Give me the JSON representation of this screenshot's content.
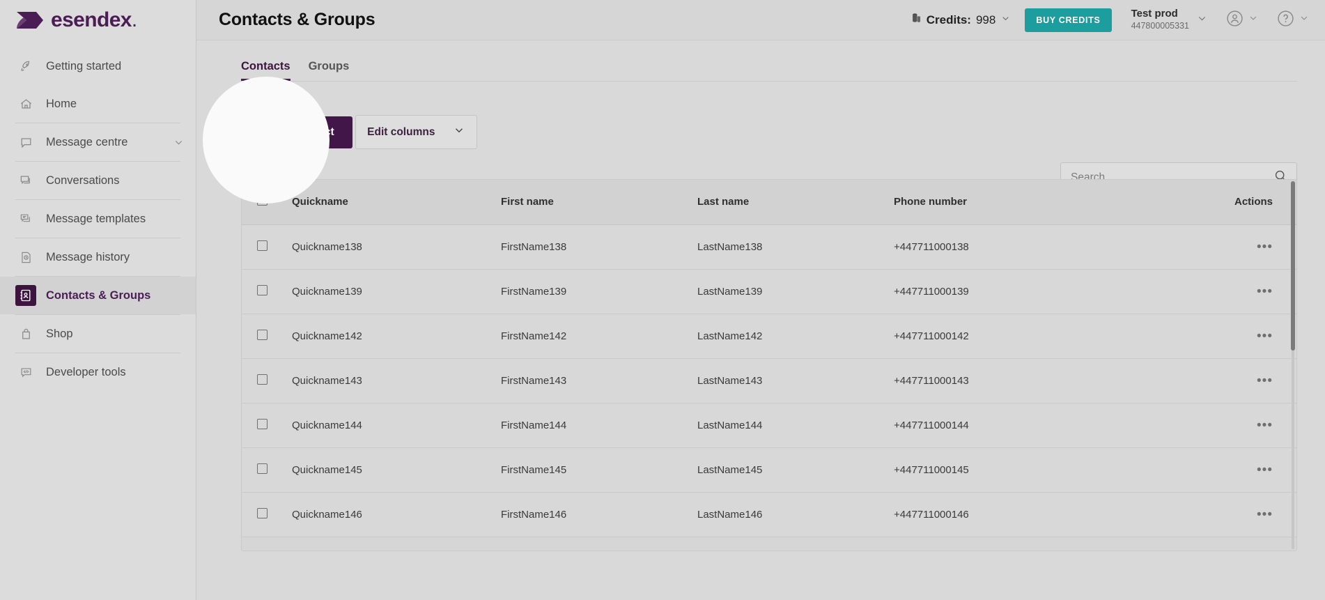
{
  "brand": {
    "logo_text": "esendex",
    "logo_dot": ".",
    "primary_purple": "#4b1d55",
    "button_purple": "#43164a",
    "teal": "#1d9e9e"
  },
  "sidebar": {
    "items": [
      {
        "label": "Getting started",
        "icon": "rocket-icon",
        "active": false,
        "chevron": false
      },
      {
        "label": "Home",
        "icon": "home-icon",
        "active": false,
        "chevron": false
      },
      {
        "label": "Message centre",
        "icon": "speech-bubble-icon",
        "active": false,
        "chevron": true
      },
      {
        "label": "Conversations",
        "icon": "conversations-icon",
        "active": false,
        "chevron": false
      },
      {
        "label": "Message templates",
        "icon": "templates-icon",
        "active": false,
        "chevron": false
      },
      {
        "label": "Message history",
        "icon": "history-icon",
        "active": false,
        "chevron": false
      },
      {
        "label": "Contacts & Groups",
        "icon": "contacts-book-icon",
        "active": true,
        "chevron": false
      },
      {
        "label": "Shop",
        "icon": "shopping-bag-icon",
        "active": false,
        "chevron": false
      },
      {
        "label": "Developer tools",
        "icon": "code-icon",
        "active": false,
        "chevron": false
      }
    ]
  },
  "header": {
    "title": "Contacts & Groups",
    "credits_label": "Credits:",
    "credits_value": "998",
    "buy_credits_label": "BUY CREDITS",
    "account_name": "Test prod",
    "account_number": "447800005331"
  },
  "tabs": [
    {
      "label": "Contacts",
      "active": true
    },
    {
      "label": "Groups",
      "active": false
    }
  ],
  "toolbar": {
    "create_contact_label": "Create contact",
    "edit_columns_label": "Edit columns"
  },
  "search": {
    "value": "",
    "placeholder": "Search"
  },
  "table": {
    "columns": [
      "Quickname",
      "First name",
      "Last name",
      "Phone number",
      "Actions"
    ],
    "rows": [
      {
        "quickname": "Quickname138",
        "first_name": "FirstName138",
        "last_name": "LastName138",
        "phone": "+447711000138"
      },
      {
        "quickname": "Quickname139",
        "first_name": "FirstName139",
        "last_name": "LastName139",
        "phone": "+447711000139"
      },
      {
        "quickname": "Quickname142",
        "first_name": "FirstName142",
        "last_name": "LastName142",
        "phone": "+447711000142"
      },
      {
        "quickname": "Quickname143",
        "first_name": "FirstName143",
        "last_name": "LastName143",
        "phone": "+447711000143"
      },
      {
        "quickname": "Quickname144",
        "first_name": "FirstName144",
        "last_name": "LastName144",
        "phone": "+447711000144"
      },
      {
        "quickname": "Quickname145",
        "first_name": "FirstName145",
        "last_name": "LastName145",
        "phone": "+447711000145"
      },
      {
        "quickname": "Quickname146",
        "first_name": "FirstName146",
        "last_name": "LastName146",
        "phone": "+447711000146"
      }
    ],
    "row_action_glyph": "•••"
  }
}
